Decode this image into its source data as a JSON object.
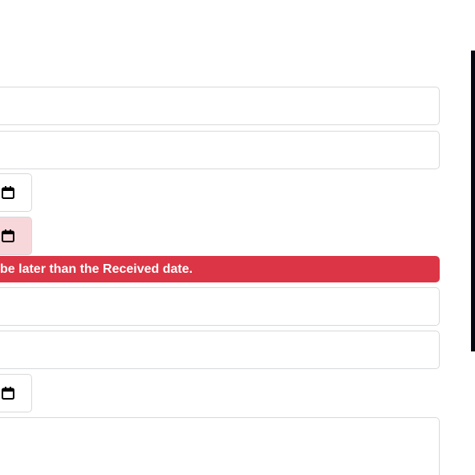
{
  "form": {
    "error_message": "be later than the Received date.",
    "fields": [
      {
        "kind": "text",
        "value": ""
      },
      {
        "kind": "text",
        "value": ""
      },
      {
        "kind": "date",
        "value": "",
        "icon": "calendar-icon"
      },
      {
        "kind": "date",
        "value": "",
        "icon": "calendar-icon",
        "state": "invalid"
      },
      {
        "kind": "text",
        "value": ""
      },
      {
        "kind": "text",
        "value": ""
      },
      {
        "kind": "date",
        "value": "",
        "icon": "calendar-icon"
      },
      {
        "kind": "textarea",
        "value": ""
      }
    ]
  },
  "colors": {
    "error_bar": "#dc3545",
    "invalid_field": "#f8d7da",
    "field_border": "#d6d9dc",
    "side_panel": "#05060f"
  }
}
